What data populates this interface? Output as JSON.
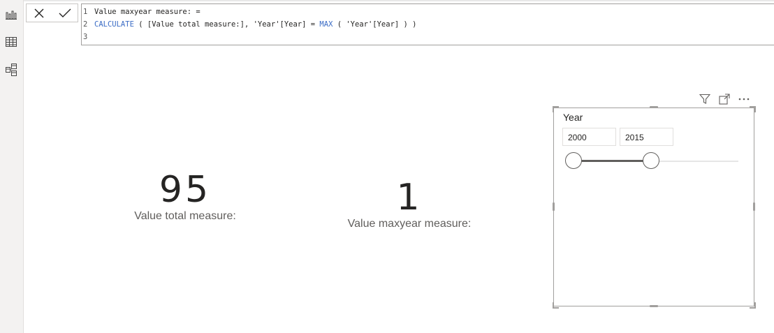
{
  "nav": {
    "icons": [
      "report-icon",
      "data-icon",
      "model-icon"
    ]
  },
  "formula_bar": {
    "lines": [
      {
        "number": "1",
        "parts": [
          {
            "text": "Value maxyear measure: =",
            "kind": "plain"
          }
        ]
      },
      {
        "number": "2",
        "parts": [
          {
            "text": "CALCULATE",
            "kind": "fn"
          },
          {
            "text": " ( [Value total measure:], 'Year'[Year] = ",
            "kind": "plain"
          },
          {
            "text": "MAX",
            "kind": "fn"
          },
          {
            "text": " ( 'Year'[Year] ) )",
            "kind": "plain"
          }
        ]
      },
      {
        "number": "3",
        "parts": []
      }
    ]
  },
  "cards": [
    {
      "value": "95",
      "label": "Value total measure:"
    },
    {
      "value": "1",
      "label": "Value maxyear measure:"
    }
  ],
  "slicer": {
    "title": "Year",
    "start": "2000",
    "end": "2015"
  },
  "colors": {
    "function": "#3b6cc5",
    "text": "#252423",
    "muted": "#605e5c",
    "border": "#a19f9d"
  }
}
